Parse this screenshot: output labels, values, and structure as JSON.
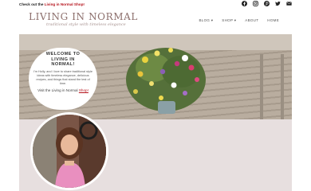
{
  "topbar": {
    "promo_prefix": "Check out the ",
    "promo_link": "Living in Normal Shop!"
  },
  "social_icons": [
    "facebook-icon",
    "instagram-icon",
    "pinterest-icon",
    "twitter-icon",
    "email-icon"
  ],
  "header": {
    "site_title": "LIVING IN NORMAL",
    "tagline": "traditional style with timeless elegance"
  },
  "nav": {
    "items": [
      {
        "label": "BLOG ▾"
      },
      {
        "label": "SHOP ▾"
      },
      {
        "label": "ABOUT"
      },
      {
        "label": "HOME"
      }
    ]
  },
  "welcome": {
    "title": "WELCOME TO LIVING IN NORMAL!",
    "intro": "I'm Holly, and I love to share traditional style ideas with timeless elegance, delicious recipes, and things that stand the test of time.",
    "shop_prefix": "Visit the Living in Normal ",
    "shop_link": "Shop!"
  },
  "colors": {
    "accent_red": "#b5121b",
    "title_mauve": "#8c6f6c",
    "band_pink": "#e7dfdf"
  }
}
